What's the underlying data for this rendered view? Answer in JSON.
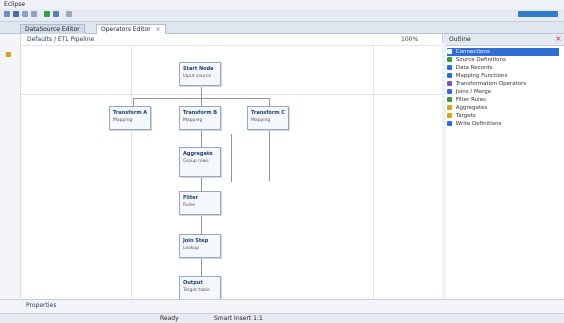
{
  "window": {
    "title": "Eclipse"
  },
  "tabs": [
    {
      "label": "DataSource Editor"
    },
    {
      "label": "Operators Editor"
    }
  ],
  "editor": {
    "breadcrumb": "Defaults / ETL Pipeline",
    "zoom": "100%"
  },
  "nodes": [
    {
      "id": "n1",
      "title": "Start Node",
      "sub": "Input source"
    },
    {
      "id": "n2",
      "title": "Transform A",
      "sub": "Mapping"
    },
    {
      "id": "n3",
      "title": "Transform B",
      "sub": "Mapping"
    },
    {
      "id": "n4",
      "title": "Transform C",
      "sub": "Mapping"
    },
    {
      "id": "n5",
      "title": "Aggregate",
      "sub": "Group rows"
    },
    {
      "id": "n6",
      "title": "Filter",
      "sub": "Rules"
    },
    {
      "id": "n7",
      "title": "Join Step",
      "sub": "Lookup"
    },
    {
      "id": "n8",
      "title": "Output",
      "sub": "Target table"
    }
  ],
  "outline": {
    "header": "Outline",
    "items": [
      {
        "label": "Connections",
        "color": "#2d6cdf"
      },
      {
        "label": "Source Definitions",
        "color": "#3a9a3a"
      },
      {
        "label": "Data Records",
        "color": "#2d6cdf"
      },
      {
        "label": "Mapping Functions",
        "color": "#2d6cdf"
      },
      {
        "label": "Transformation Operators",
        "color": "#7a56c2"
      },
      {
        "label": "Joins / Merge",
        "color": "#2d6cdf"
      },
      {
        "label": "Filter Rules",
        "color": "#3a9a3a"
      },
      {
        "label": "Aggregates",
        "color": "#d8a318"
      },
      {
        "label": "Targets",
        "color": "#d8a318"
      },
      {
        "label": "Write Definitions",
        "color": "#2d6cdf"
      }
    ]
  },
  "bottom": {
    "tab": "Properties"
  },
  "status": {
    "left": "Ready",
    "mid": "Smart Insert 1:1"
  }
}
